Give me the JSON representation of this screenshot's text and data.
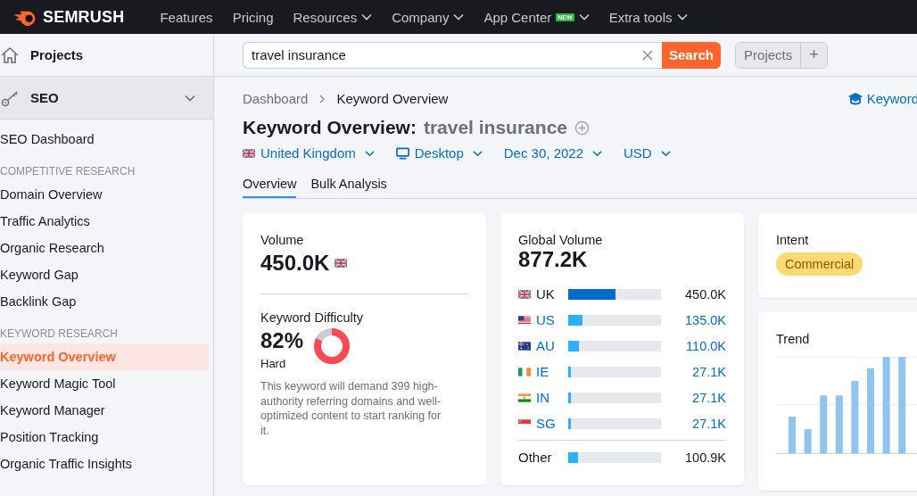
{
  "topnav": {
    "logo": "SEMRUSH",
    "items": [
      {
        "label": "Features",
        "dropdown": false
      },
      {
        "label": "Pricing",
        "dropdown": false
      },
      {
        "label": "Resources",
        "dropdown": true
      },
      {
        "label": "Company",
        "dropdown": true
      },
      {
        "label": "App Center",
        "dropdown": true,
        "badge": "NEW"
      },
      {
        "label": "Extra tools",
        "dropdown": true
      }
    ]
  },
  "sidebar": {
    "projects": "Projects",
    "section": {
      "label": "SEO",
      "expanded": true
    },
    "groups": [
      {
        "items": [
          {
            "label": "SEO Dashboard",
            "selected": false
          }
        ]
      },
      {
        "heading": "COMPETITIVE RESEARCH",
        "items": [
          {
            "label": "Domain Overview",
            "selected": false
          },
          {
            "label": "Traffic Analytics",
            "selected": false
          },
          {
            "label": "Organic Research",
            "selected": false
          },
          {
            "label": "Keyword Gap",
            "selected": false
          },
          {
            "label": "Backlink Gap",
            "selected": false
          }
        ]
      },
      {
        "heading": "KEYWORD RESEARCH",
        "items": [
          {
            "label": "Keyword Overview",
            "selected": true
          },
          {
            "label": "Keyword Magic Tool",
            "selected": false
          },
          {
            "label": "Keyword Manager",
            "selected": false
          },
          {
            "label": "Position Tracking",
            "selected": false
          },
          {
            "label": "Organic Traffic Insights",
            "selected": false
          }
        ]
      }
    ]
  },
  "searchbar": {
    "value": "travel insurance",
    "button": "Search",
    "projects": "Projects",
    "add": "+"
  },
  "breadcrumb": [
    "Dashboard",
    "Keyword Overview"
  ],
  "help_link": "Keyword",
  "title": {
    "label": "Keyword Overview:",
    "keyword": "travel insurance"
  },
  "filters": [
    {
      "kind": "flag",
      "label": "United Kingdom"
    },
    {
      "kind": "device",
      "label": "Desktop"
    },
    {
      "kind": "plain",
      "label": "Dec 30, 2022"
    },
    {
      "kind": "plain",
      "label": "USD"
    }
  ],
  "tabs": [
    {
      "label": "Overview",
      "selected": true
    },
    {
      "label": "Bulk Analysis",
      "selected": false
    }
  ],
  "volume": {
    "label": "Volume",
    "value": "450.0K"
  },
  "difficulty": {
    "label": "Keyword Difficulty",
    "value": "82%",
    "rating": "Hard",
    "description": "This keyword will demand 399 high-authority referring domains and well-optimized content to start ranking for it."
  },
  "global_volume": {
    "label": "Global Volume",
    "value": "877.2K",
    "countries": [
      {
        "kind": "uk",
        "code": "UK",
        "value": "450.0K",
        "level": 0.51,
        "selected": true
      },
      {
        "kind": "us",
        "code": "US",
        "value": "135.0K",
        "level": 0.15,
        "selected": false
      },
      {
        "kind": "au",
        "code": "AU",
        "value": "110.0K",
        "level": 0.12,
        "selected": false
      },
      {
        "kind": "ie",
        "code": "IE",
        "value": "27.1K",
        "level": 0.03,
        "selected": false
      },
      {
        "kind": "in",
        "code": "IN",
        "value": "27.1K",
        "level": 0.03,
        "selected": false
      },
      {
        "kind": "sg",
        "code": "SG",
        "value": "27.1K",
        "level": 0.03,
        "selected": false
      }
    ],
    "other": {
      "label": "Other",
      "value": "100.9K",
      "level": 0.11
    }
  },
  "intent": {
    "label": "Intent",
    "badge": "Commercial"
  },
  "trend": {
    "label": "Trend"
  }
}
